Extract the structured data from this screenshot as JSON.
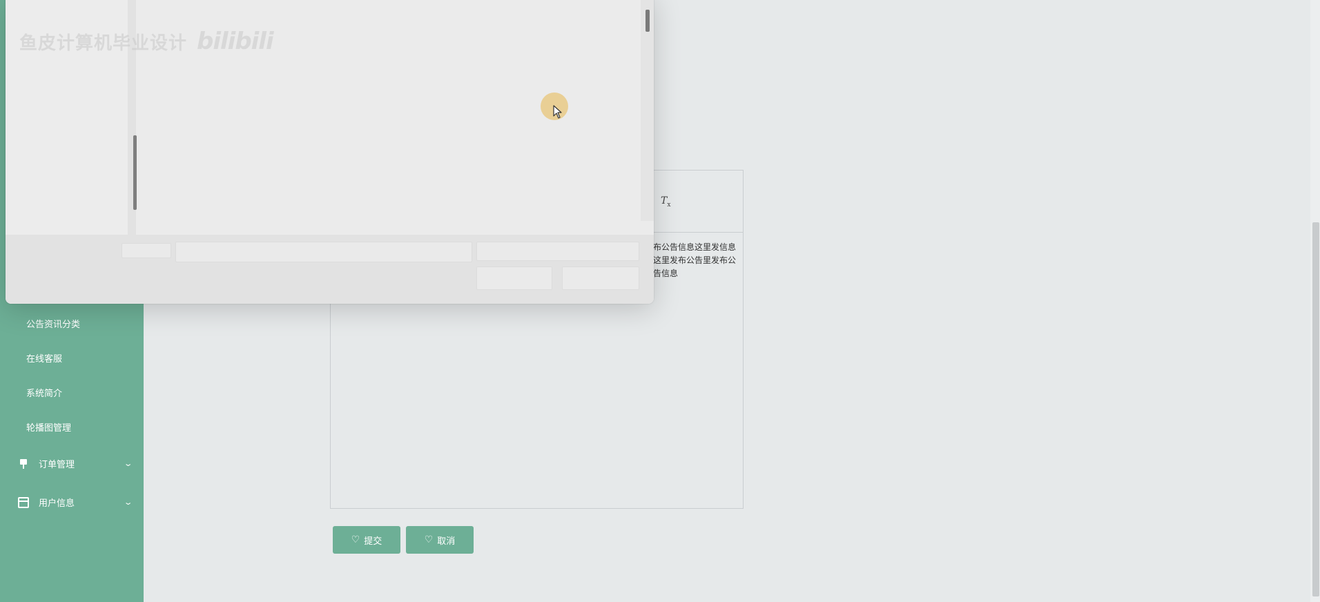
{
  "sidebar": {
    "items": [
      {
        "label": "公告资讯分类"
      },
      {
        "label": "在线客服"
      },
      {
        "label": "系统简介"
      },
      {
        "label": "轮播图管理"
      }
    ],
    "groups": [
      {
        "label": "订单管理",
        "icon": "pin-icon"
      },
      {
        "label": "用户信息",
        "icon": "card-icon"
      }
    ]
  },
  "editor": {
    "clear_format_icon": "clear-format-icon",
    "content": "布公告信息这里发信息这里发布公告里发布公告信息"
  },
  "buttons": {
    "submit": "提交",
    "cancel": "取消"
  },
  "overlay": {
    "watermark_text": "鱼皮计算机毕业设计",
    "watermark_logo": "bilibili"
  },
  "colors": {
    "accent": "#6daf96",
    "background": "#e6e9ea"
  }
}
